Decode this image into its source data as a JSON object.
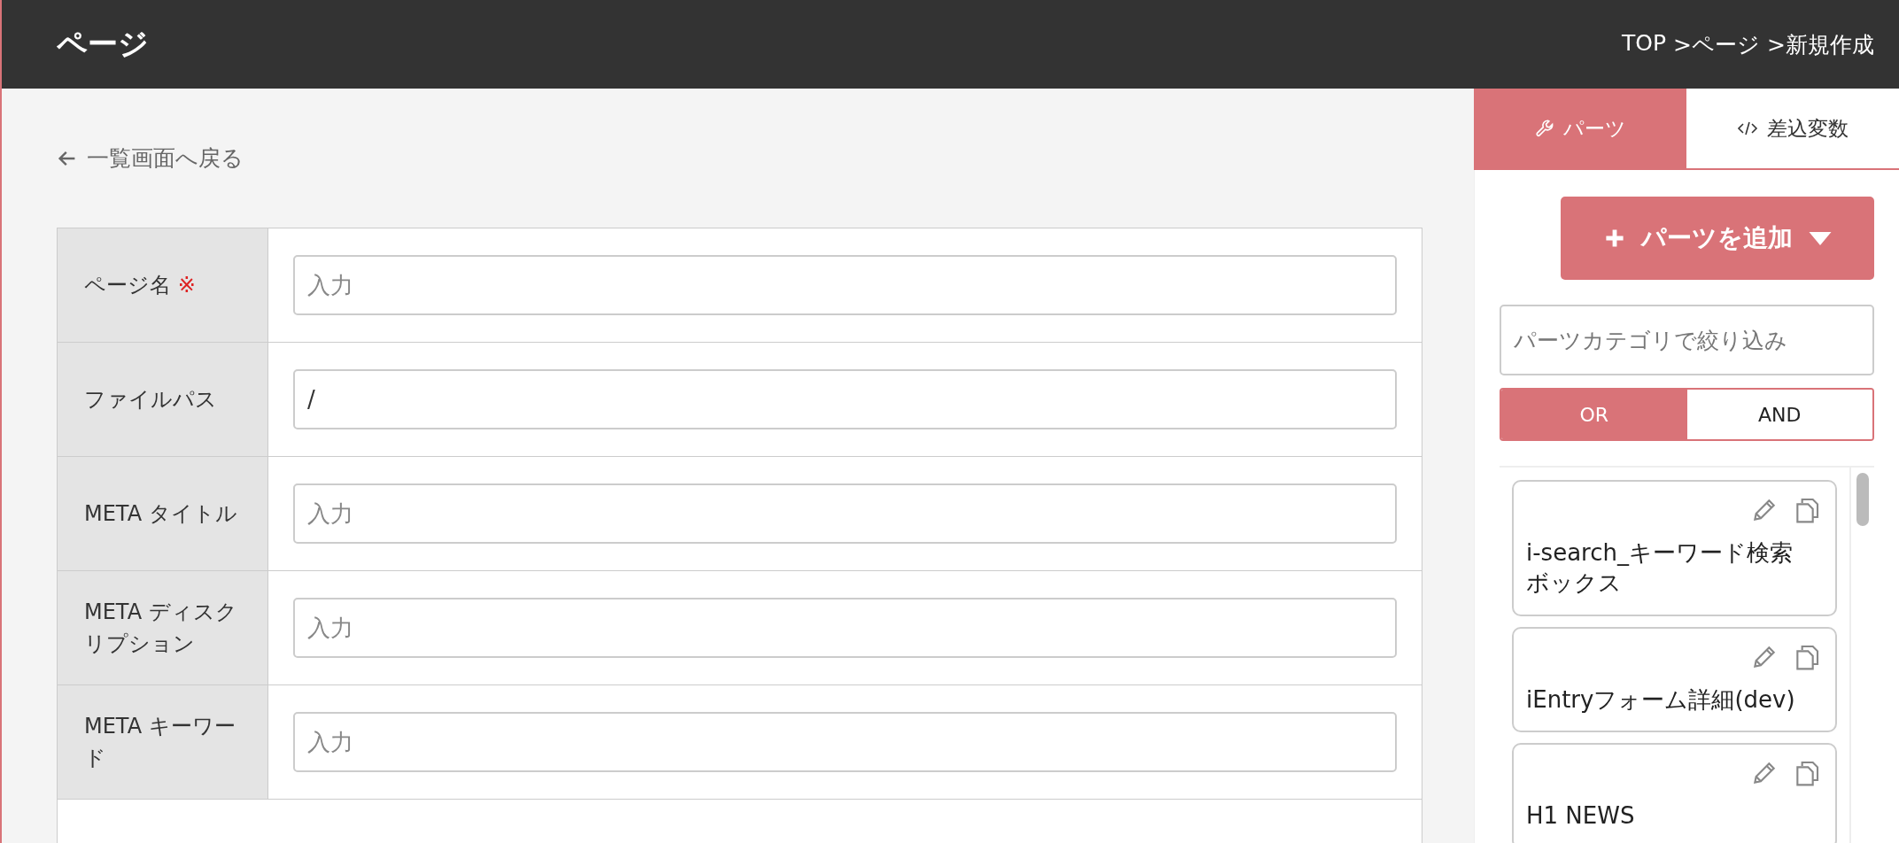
{
  "header": {
    "title": "ページ",
    "breadcrumbs": [
      "TOP",
      ">ページ",
      ">新規作成"
    ]
  },
  "back_link": "一覧画面へ戻る",
  "form": {
    "rows": [
      {
        "label": "ページ名",
        "required_mark": "※",
        "placeholder": "入力"
      },
      {
        "label": "ファイルパス",
        "value": "/"
      },
      {
        "label": "META タイトル",
        "placeholder": "入力"
      },
      {
        "label": "META ディスクリプション",
        "placeholder": "入力"
      },
      {
        "label": "META キーワード",
        "placeholder": "入力"
      }
    ]
  },
  "panel": {
    "tabs": [
      {
        "label": "パーツ",
        "kind": "wrench",
        "selected": true
      },
      {
        "label": "差込変数",
        "kind": "code",
        "selected": false
      }
    ],
    "add_button": "パーツを追加",
    "filter": {
      "placeholder": "パーツカテゴリで絞り込み"
    },
    "logic": [
      {
        "label": "OR",
        "selected": true
      },
      {
        "label": "AND",
        "selected": false
      }
    ],
    "parts": [
      {
        "name": "i-search_キーワード検索ボックス"
      },
      {
        "name": "iEntryフォーム詳細(dev)"
      },
      {
        "name": "H1 NEWS"
      }
    ]
  }
}
